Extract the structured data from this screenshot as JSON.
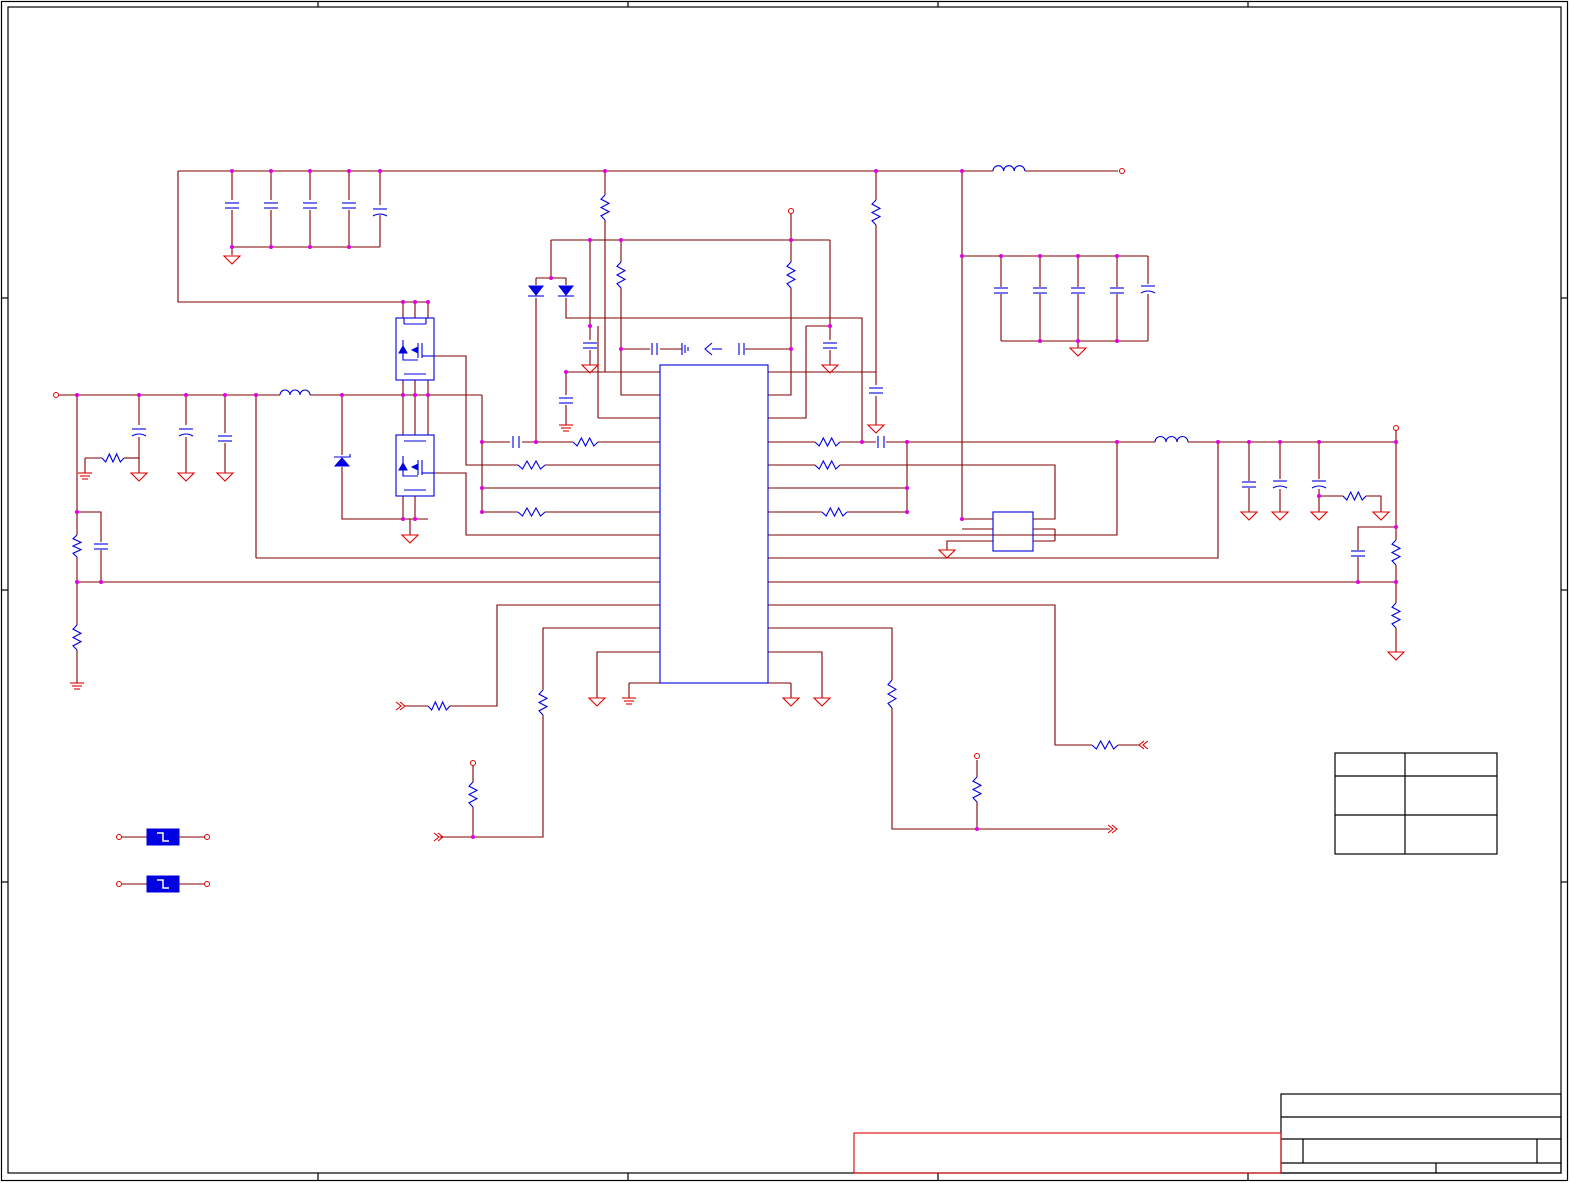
{
  "schematic": {
    "title_block": {
      "title": "",
      "sheet": "",
      "rev": ""
    },
    "revision_table": {
      "rows": [
        [
          "",
          ""
        ],
        [
          "",
          ""
        ],
        [
          "",
          ""
        ]
      ]
    },
    "components": {
      "ic": "main-controller-ic",
      "mosfets": [
        "q-high-side",
        "q-low-side"
      ],
      "inductors": [
        "input-inductor",
        "output-inductor",
        "top-right-inductor"
      ],
      "fuses": [
        "fuse-1",
        "fuse-2"
      ]
    },
    "colors": {
      "wire": "#800000",
      "symbol": "#0000e0",
      "ground_and_ports": "#e00000",
      "junction": "#e000e0",
      "border": "#000000"
    }
  }
}
